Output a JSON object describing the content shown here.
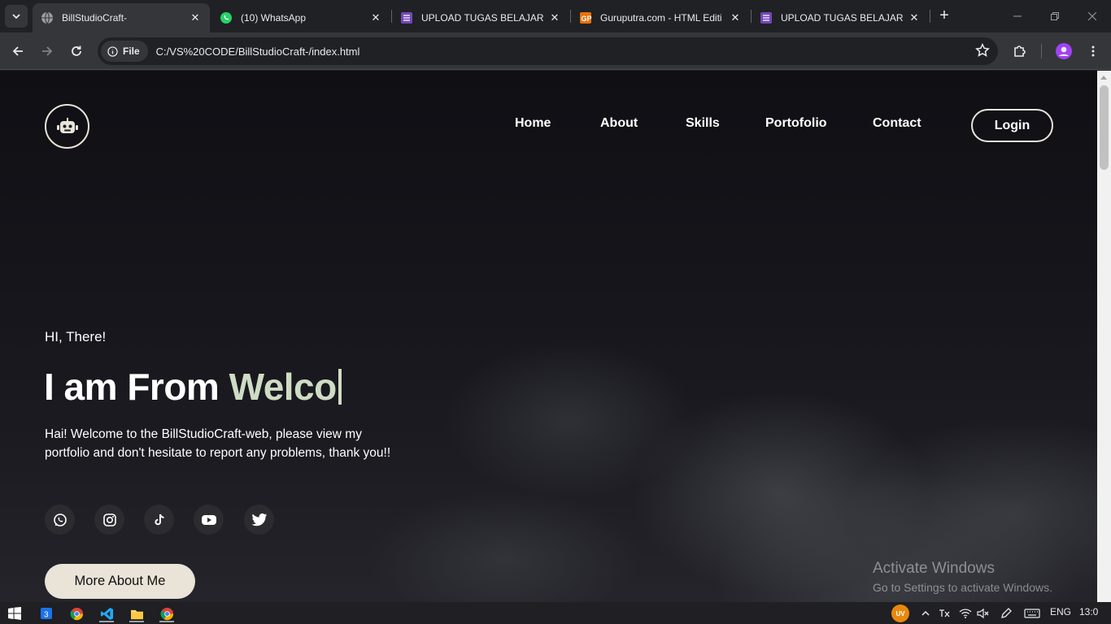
{
  "browser": {
    "tabs": [
      {
        "title": "BillStudioCraft-",
        "icon": "globe-icon",
        "active": true
      },
      {
        "title": "(10) WhatsApp",
        "icon": "whatsapp-icon",
        "active": false
      },
      {
        "title": "UPLOAD TUGAS BELAJAR",
        "icon": "forms-icon",
        "active": false
      },
      {
        "title": "Guruputra.com - HTML Editi",
        "icon": "gp-icon",
        "active": false
      },
      {
        "title": "UPLOAD TUGAS BELAJAR",
        "icon": "forms-icon",
        "active": false
      }
    ],
    "address": {
      "chip_label": "File",
      "url": "C:/VS%20CODE/BillStudioCraft-/index.html"
    }
  },
  "page": {
    "nav": [
      "Home",
      "About",
      "Skills",
      "Portofolio",
      "Contact"
    ],
    "login_label": "Login",
    "greeting": "HI, There!",
    "headline_prefix": "I am From",
    "headline_typed": "Welco",
    "description": "Hai! Welcome to the BillStudioCraft-web, please view my portfolio and don't hesitate to report any problems, thank you!!",
    "social_icons": [
      "whatsapp-icon",
      "instagram-icon",
      "tiktok-icon",
      "youtube-icon",
      "twitter-icon"
    ],
    "cta_label": "More About Me",
    "colors": {
      "accent": "#cfdcc4",
      "button": "#e9e3d8"
    }
  },
  "watermark": {
    "line1": "Activate Windows",
    "line2": "Go to Settings to activate Windows."
  },
  "taskbar": {
    "avatar_label": "UV",
    "language": "ENG",
    "time": "13:0"
  }
}
